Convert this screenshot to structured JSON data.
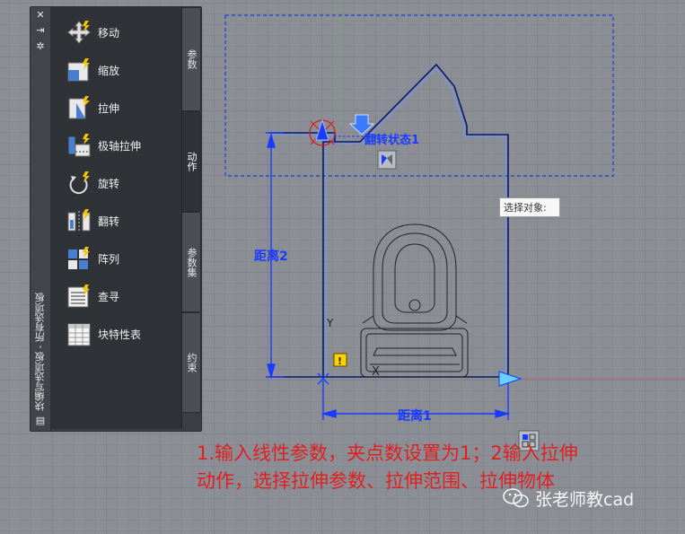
{
  "palette": {
    "title": "块编写选项板 - 所有选项板",
    "tools": [
      {
        "label": "移动",
        "icon": "move-icon"
      },
      {
        "label": "缩放",
        "icon": "scale-icon"
      },
      {
        "label": "拉伸",
        "icon": "stretch-icon"
      },
      {
        "label": "极轴拉伸",
        "icon": "polar-stretch-icon"
      },
      {
        "label": "旋转",
        "icon": "rotate-icon"
      },
      {
        "label": "翻转",
        "icon": "flip-icon"
      },
      {
        "label": "阵列",
        "icon": "array-icon"
      },
      {
        "label": "查寻",
        "icon": "lookup-icon"
      },
      {
        "label": "块特性表",
        "icon": "block-table-icon"
      }
    ],
    "tabs": [
      {
        "label": "参数",
        "active": false
      },
      {
        "label": "动作",
        "active": true
      },
      {
        "label": "参数集",
        "active": false
      },
      {
        "label": "约束",
        "active": false
      }
    ]
  },
  "drawing": {
    "flip_label": "翻转状态1",
    "dim_vertical": "距离2",
    "dim_horizontal": "距离1",
    "ucs_y": "Y",
    "ucs_x": "X",
    "warning_glyph": "!",
    "dimension_color": "#1a3cff",
    "selection_color": "#3a6aff"
  },
  "tooltip": {
    "text": "选择对象:"
  },
  "caption": {
    "line1": "1.输入线性参数，夹点数设置为1；2输入拉伸",
    "line2": "动作，选择拉伸参数、拉伸范围、拉伸物体"
  },
  "watermark": {
    "text": "张老师教cad"
  }
}
